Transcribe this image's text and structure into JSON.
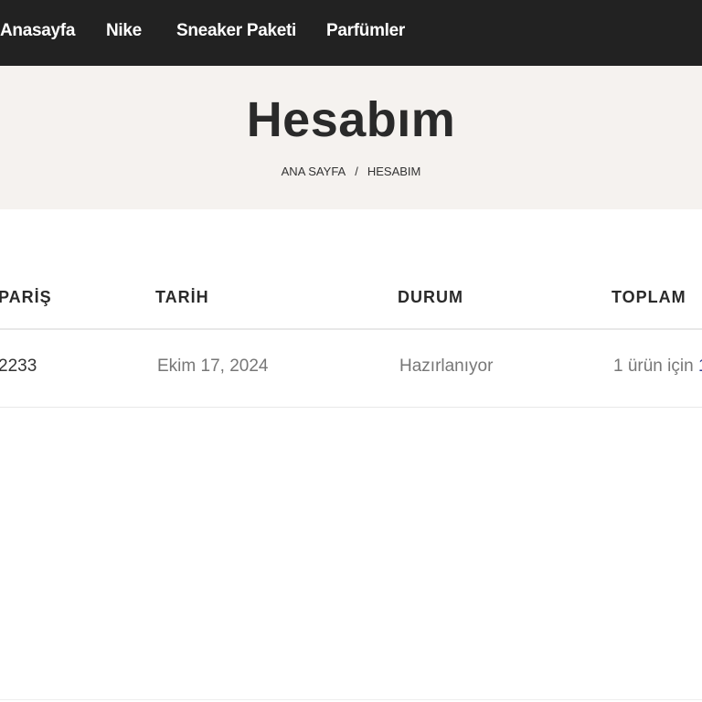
{
  "nav": {
    "items": [
      {
        "label": "Anasayfa"
      },
      {
        "label": "Nike"
      },
      {
        "label": "Sneaker Paketi"
      },
      {
        "label": "Parfümler"
      }
    ]
  },
  "hero": {
    "title": "Hesabım",
    "breadcrumb": {
      "home": "ANA SAYFA",
      "separator": "/",
      "current": "HESABIM"
    }
  },
  "orders": {
    "headers": {
      "order": "PARİŞ",
      "date": "TARİH",
      "status": "DURUM",
      "total": "TOPLAM"
    },
    "rows": [
      {
        "order": "2233",
        "date": "Ekim 17, 2024",
        "status": "Hazırlanıyor",
        "total_prefix": "1 ürün için",
        "total_amount": "1"
      }
    ]
  },
  "colors": {
    "nav_bg": "#222222",
    "hero_bg": "#f5f2ef",
    "accent": "#2b3a8c"
  }
}
